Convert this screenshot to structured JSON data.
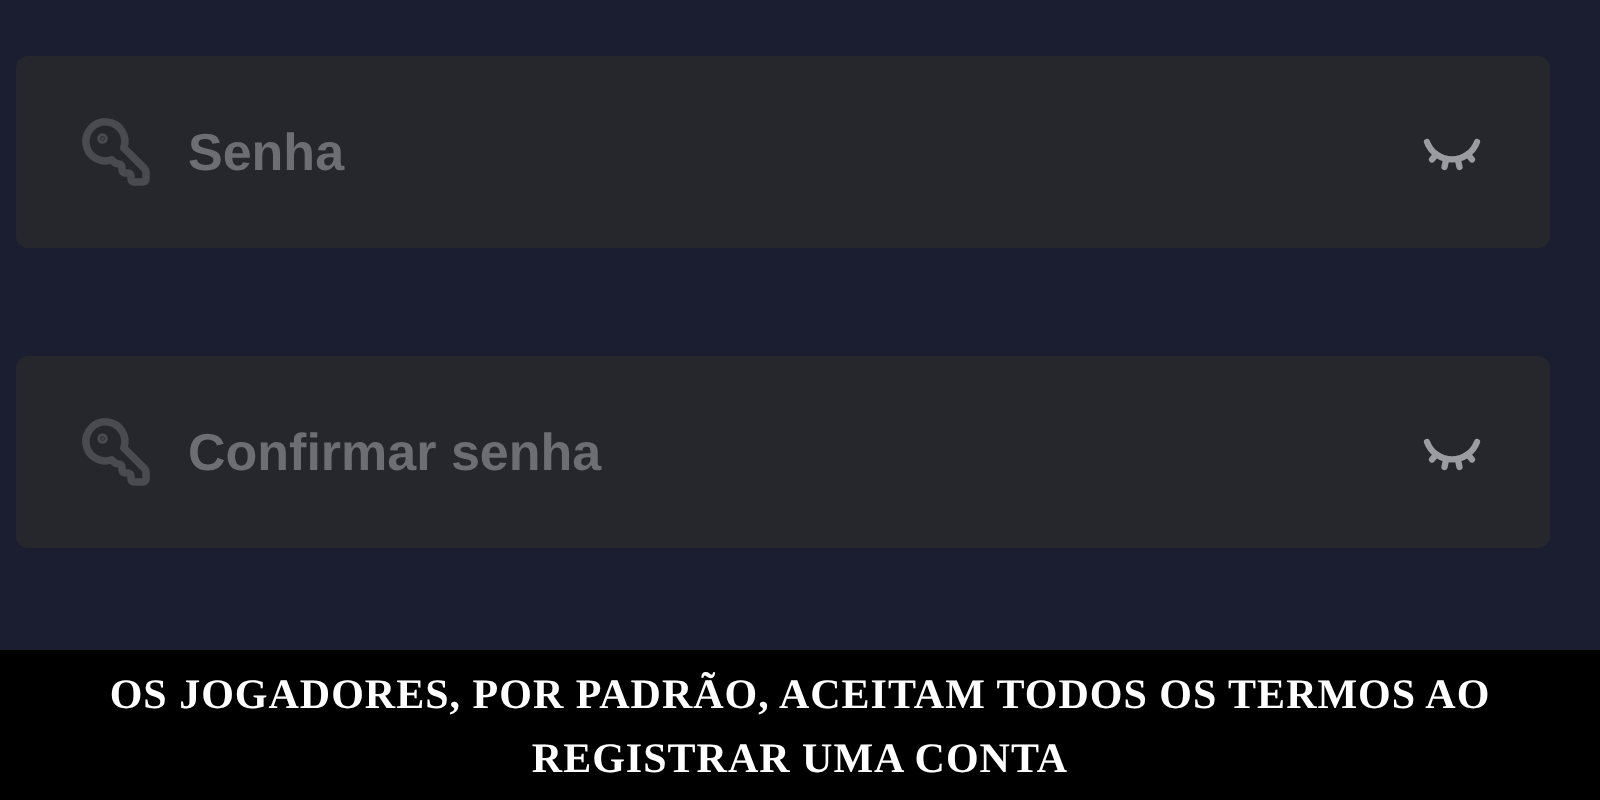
{
  "fields": [
    {
      "placeholder": "Senha",
      "masked": true
    },
    {
      "placeholder": "Confirmar senha",
      "masked": true
    }
  ],
  "caption": "OS JOGADORES, POR PADRÃO, ACEITAM TODOS OS TERMOS AO REGISTRAR UMA CONTA"
}
